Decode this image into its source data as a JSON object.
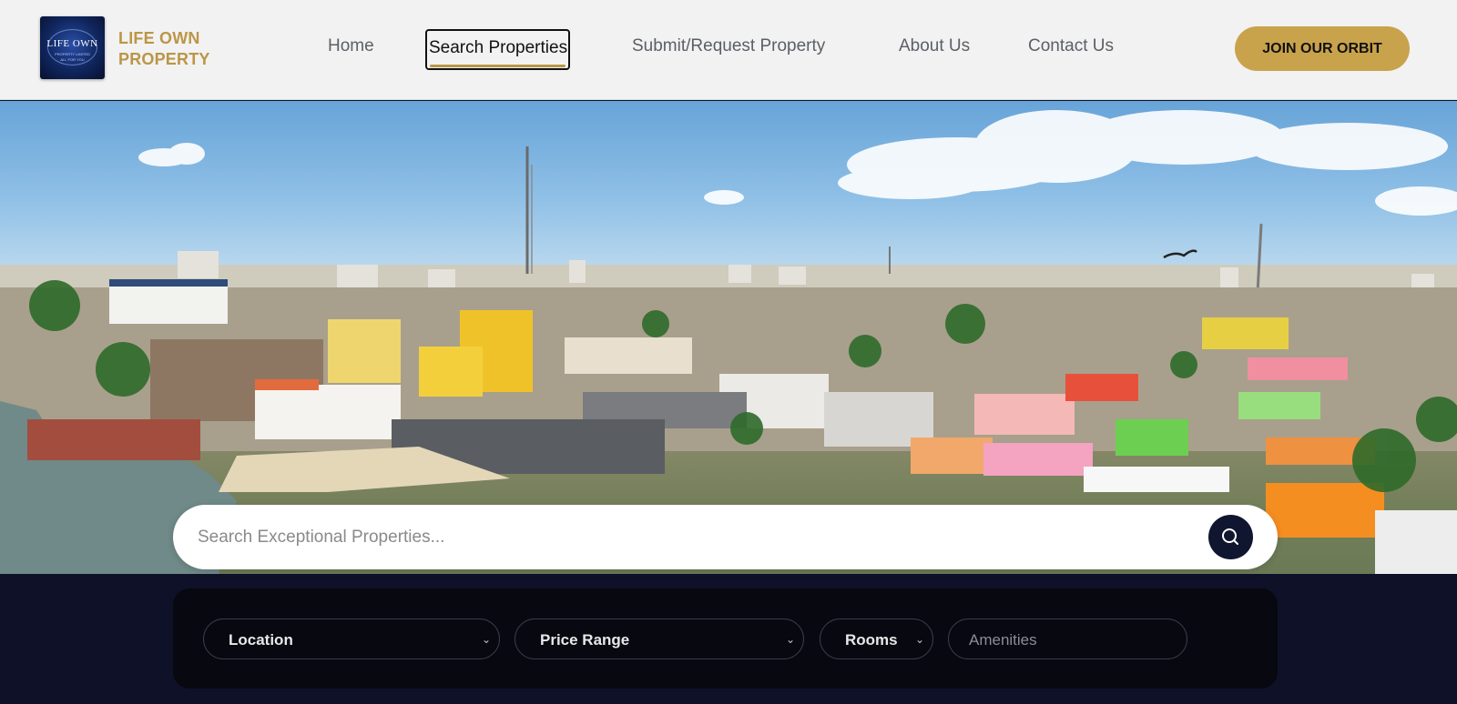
{
  "brand": {
    "line1": "LIFE OWN",
    "line2": "PROPERTY",
    "logo_text": "LIFE OWN",
    "logo_sub1": "PROPERTY LIMITED",
    "logo_sub2": "ALL FOR YOU"
  },
  "nav": [
    {
      "label": "Home"
    },
    {
      "label": "Search Properties",
      "active": true
    },
    {
      "label": "Submit/Request Property"
    },
    {
      "label": "About Us"
    },
    {
      "label": "Contact Us"
    }
  ],
  "cta": {
    "label": "JOIN OUR ORBIT"
  },
  "search": {
    "placeholder": "Search Exceptional Properties...",
    "icon": "search-icon"
  },
  "filters": {
    "location": "Location",
    "price_range": "Price Range",
    "rooms": "Rooms",
    "amenities_placeholder": "Amenities"
  },
  "colors": {
    "gold": "#c9a24c",
    "navy": "#101530",
    "header_bg": "#f2f2f2"
  }
}
